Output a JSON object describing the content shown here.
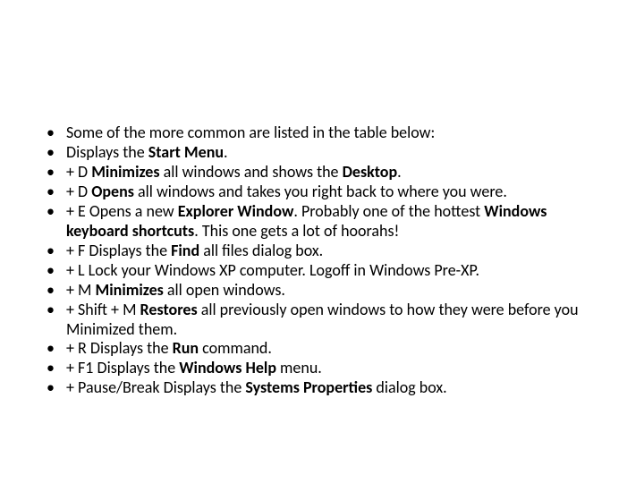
{
  "bullets": [
    {
      "text": "Some of the more common are listed in the table below:",
      "bold": []
    },
    {
      "text": "Displays the Start Menu.",
      "bold": [
        "Start Menu"
      ]
    },
    {
      "text": "+ D Minimizes all windows and shows the Desktop.",
      "bold": [
        "Minimizes",
        "Desktop"
      ]
    },
    {
      "text": "+ D Opens all windows and takes you right back to where you were.",
      "bold": [
        "Opens"
      ]
    },
    {
      "text": "+ E Opens a new Explorer Window. Probably one of the hottest Windows keyboard shortcuts. This one gets a lot of hoorahs!",
      "bold": [
        "Explorer Window",
        "Windows keyboard shortcuts"
      ]
    },
    {
      "text": "+ F Displays the Find all files dialog box.",
      "bold": [
        "Find"
      ]
    },
    {
      "text": "+ L Lock your Windows XP computer. Logoff in Windows Pre-XP.",
      "bold": []
    },
    {
      "text": "+ M Minimizes all open windows.",
      "bold": [
        "Minimizes"
      ]
    },
    {
      "text": "+ Shift + M Restores all previously open windows to how they were before you Minimized them.",
      "bold": [
        "Restores"
      ]
    },
    {
      "text": "+ R Displays the Run command.",
      "bold": [
        "Run"
      ]
    },
    {
      "text": "+ F1 Displays the Windows Help menu.",
      "bold": [
        "Windows Help"
      ]
    },
    {
      "text": "+ Pause/Break Displays the Systems Properties dialog box.",
      "bold": [
        "Systems Properties"
      ]
    }
  ]
}
